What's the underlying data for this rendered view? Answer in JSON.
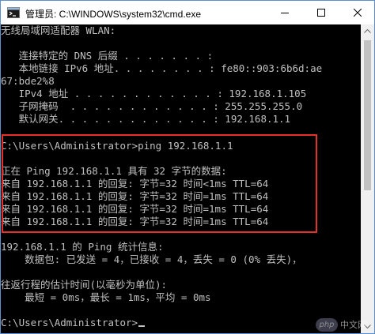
{
  "window": {
    "title": "管理员: C:\\WINDOWS\\system32\\cmd.exe",
    "controls": {
      "minimize_icon": "minimize-icon",
      "maximize_icon": "maximize-icon",
      "close_icon": "close-icon"
    }
  },
  "console": {
    "lines": [
      "无线局域网适配器 WLAN:",
      "",
      "   连接特定的 DNS 后缀 . . . . . . . :",
      "   本地链接 IPv6 地址. . . . . . . . : fe80::903:6b6d:ae",
      "67:bde2%8",
      "   IPv4 地址 . . . . . . . . . . . . : 192.168.1.105",
      "   子网掩码  . . . . . . . . . . . . : 255.255.255.0",
      "   默认网关. . . . . . . . . . . . . : 192.168.1.1",
      "",
      "C:\\Users\\Administrator>ping 192.168.1.1",
      "",
      "正在 Ping 192.168.1.1 具有 32 字节的数据:",
      "来自 192.168.1.1 的回复: 字节=32 时间<1ms TTL=64",
      "来自 192.168.1.1 的回复: 字节=32 时间=1ms TTL=64",
      "来自 192.168.1.1 的回复: 字节=32 时间=1ms TTL=64",
      "来自 192.168.1.1 的回复: 字节=32 时间=1ms TTL=64",
      "",
      "192.168.1.1 的 Ping 统计信息:",
      "    数据包: 已发送 = 4，已接收 = 4，丢失 = 0 (0% 丢失)，",
      "",
      "往返行程的估计时间(以毫秒为单位):",
      "    最短 = 0ms，最长 = 1ms，平均 = 0ms",
      "",
      "C:\\Users\\Administrator>"
    ]
  },
  "watermark": {
    "badge": "php",
    "text": "中文网"
  },
  "colors": {
    "console_background": "#000000",
    "console_text": "#c0c0c0",
    "highlight_border": "#e8302a",
    "titlebar_background": "#ffffff",
    "window_border": "#5a8fd0"
  }
}
